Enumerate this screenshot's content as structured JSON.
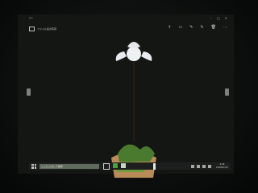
{
  "window": {
    "top_left_text": "Jan",
    "title": "ファイル名の写真",
    "minimize": "–",
    "maximize": "□",
    "close": "×"
  },
  "toolbar": {
    "icons": [
      "share-icon",
      "slideshow-icon",
      "edit-icon",
      "rotate-icon",
      "delete-icon",
      "more-icon"
    ]
  },
  "taskbar": {
    "search_placeholder": "ここに入力して検索",
    "clock_time": "9:46",
    "clock_date": "2019/01/07"
  },
  "colors": {
    "background": "#0a0c0b",
    "taskbar": "#1d1f1e",
    "search": "#606a5e",
    "flower": "#eef1f3",
    "leaf": "#4a7a2e"
  }
}
